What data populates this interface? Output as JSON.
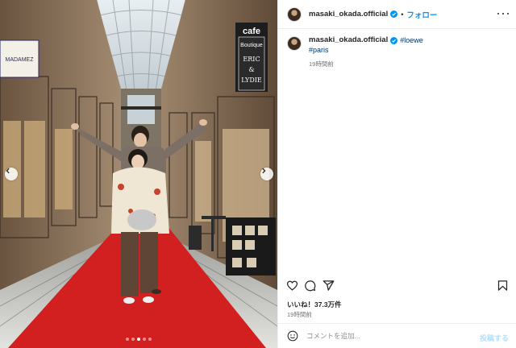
{
  "post": {
    "username": "masaki_okada.official",
    "follow_separator": "•",
    "follow_label": "フォロー",
    "caption_username": "masaki_okada.official",
    "hashtags": [
      "#loewe",
      "#paris"
    ],
    "caption_time": "19時間前",
    "likes_text": "いいね！37.3万件",
    "post_time": "19時間前",
    "comment_placeholder": "コメントを追加...",
    "post_button": "投稿する"
  },
  "photo": {
    "signs": {
      "cafe": "cafe",
      "boutique": "Boutique",
      "eric_line1": "ERIC",
      "eric_line2": "&",
      "eric_line3": "LYDIE",
      "left_sign": "MADAMEZ"
    },
    "carousel": {
      "slide_count": 5,
      "active_index": 2
    }
  },
  "colors": {
    "accent": "#0095f6",
    "hashtag": "#00376b",
    "muted": "#737373",
    "carpet": "#d21f1f",
    "verified": "#0095f6"
  },
  "icons": [
    "heart-icon",
    "comment-icon",
    "share-icon",
    "bookmark-icon",
    "emoji-icon",
    "more-icon",
    "verified-icon",
    "chevron-left-icon",
    "chevron-right-icon"
  ]
}
